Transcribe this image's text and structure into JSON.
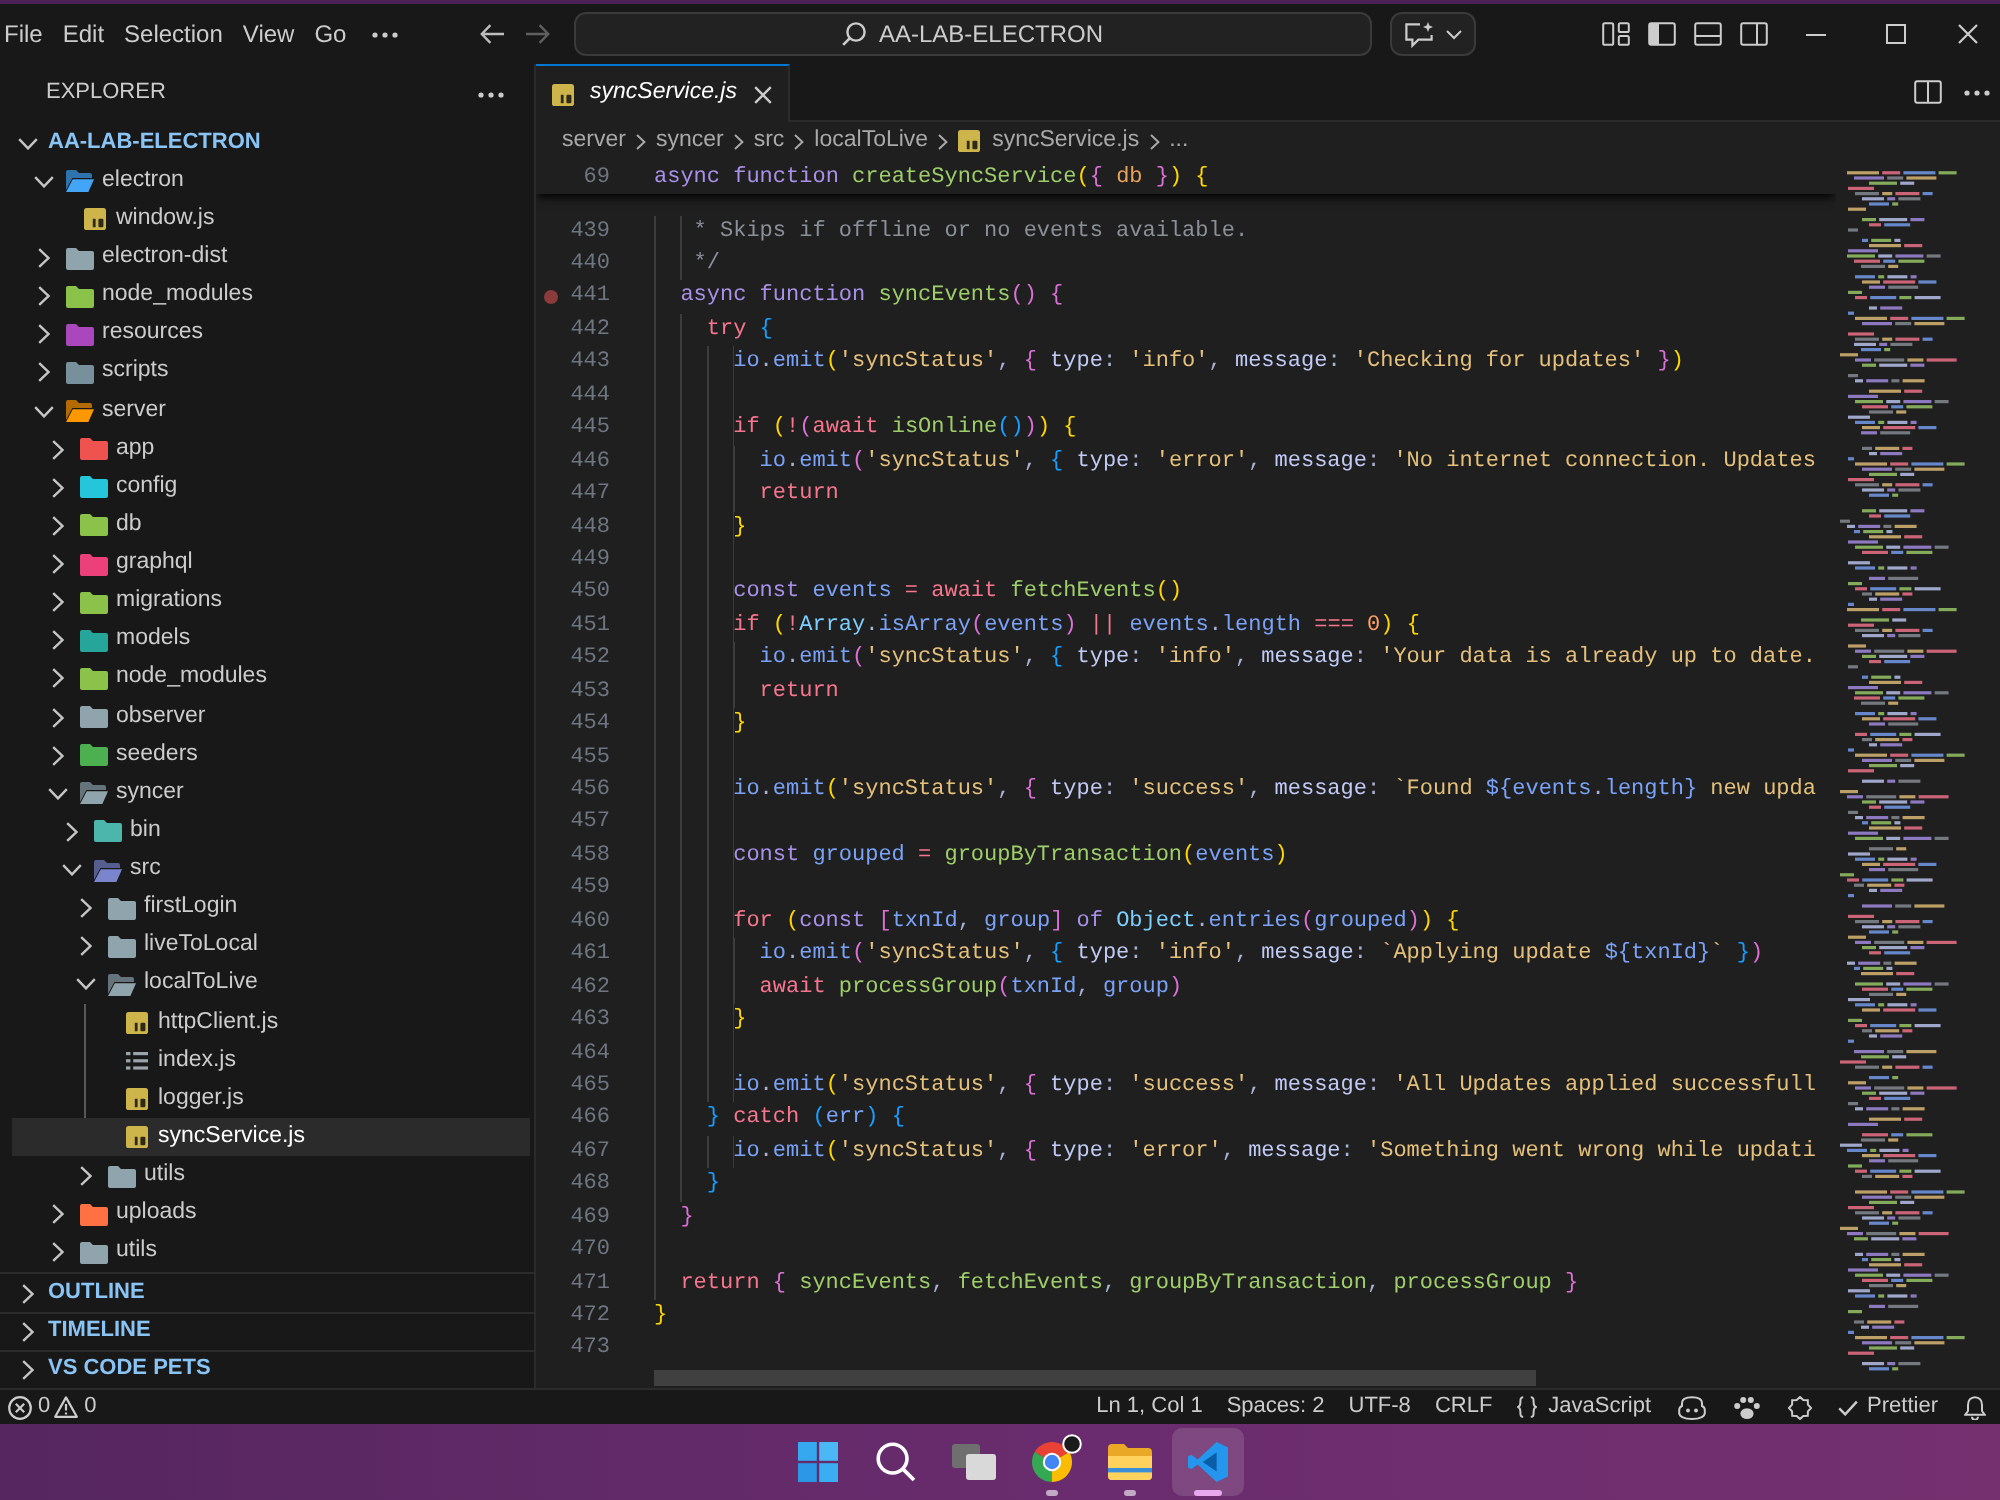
{
  "menu_bar": {
    "items": [
      "File",
      "Edit",
      "Selection",
      "View",
      "Go"
    ]
  },
  "navigation": [
    {
      "kind": "back",
      "disabled": false
    },
    {
      "kind": "forward",
      "disabled": true
    }
  ],
  "command_center": {
    "text": "AA-LAB-ELECTRON"
  },
  "layout_toggles": [
    {
      "kind": "customize",
      "on": false
    },
    {
      "kind": "primary_sidebar",
      "on": true
    },
    {
      "kind": "panel",
      "on": false
    },
    {
      "kind": "secondary_sidebar",
      "on": false
    }
  ],
  "sidebar": {
    "title": "EXPLORER",
    "root": {
      "label": "AA-LAB-ELECTRON",
      "expanded": true
    },
    "tree": [
      {
        "label": "electron",
        "kind": "folder",
        "color": "#42a5f5",
        "expanded": true,
        "selected": false,
        "children": [
          {
            "label": "window.js",
            "kind": "script",
            "selected": false
          }
        ]
      },
      {
        "label": "electron-dist",
        "kind": "folder",
        "color": "#90a4ae",
        "expanded": false,
        "selected": false
      },
      {
        "label": "node_modules",
        "kind": "folder",
        "color": "#8bc34a",
        "expanded": false,
        "selected": false
      },
      {
        "label": "resources",
        "kind": "folder",
        "color": "#ab47bc",
        "expanded": false,
        "selected": false
      },
      {
        "label": "scripts",
        "kind": "folder",
        "color": "#78909c",
        "expanded": false,
        "selected": false
      },
      {
        "label": "server",
        "kind": "folder",
        "color": "#ff9800",
        "expanded": true,
        "selected": false,
        "children": [
          {
            "label": "app",
            "kind": "folder",
            "color": "#ef5350",
            "expanded": false,
            "selected": false
          },
          {
            "label": "config",
            "kind": "folder",
            "color": "#26c6da",
            "expanded": false,
            "selected": false
          },
          {
            "label": "db",
            "kind": "folder",
            "color": "#8bc34a",
            "expanded": false,
            "selected": false
          },
          {
            "label": "graphql",
            "kind": "folder",
            "color": "#ec407a",
            "expanded": false,
            "selected": false
          },
          {
            "label": "migrations",
            "kind": "folder",
            "color": "#8bc34a",
            "expanded": false,
            "selected": false
          },
          {
            "label": "models",
            "kind": "folder",
            "color": "#26a69a",
            "expanded": false,
            "selected": false
          },
          {
            "label": "node_modules",
            "kind": "folder",
            "color": "#8bc34a",
            "expanded": false,
            "selected": false
          },
          {
            "label": "observer",
            "kind": "folder",
            "color": "#90a4ae",
            "expanded": false,
            "selected": false
          },
          {
            "label": "seeders",
            "kind": "folder",
            "color": "#4caf50",
            "expanded": false,
            "selected": false
          },
          {
            "label": "syncer",
            "kind": "folder",
            "color": "#90a4ae",
            "expanded": true,
            "selected": false,
            "children": [
              {
                "label": "bin",
                "kind": "folder",
                "color": "#4db6ac",
                "expanded": false,
                "selected": false
              },
              {
                "label": "src",
                "kind": "folder",
                "color": "#7986cb",
                "expanded": true,
                "selected": false,
                "children": [
                  {
                    "label": "firstLogin",
                    "kind": "folder",
                    "color": "#90a4ae",
                    "expanded": false,
                    "selected": false
                  },
                  {
                    "label": "liveToLocal",
                    "kind": "folder",
                    "color": "#90a4ae",
                    "expanded": false,
                    "selected": false
                  },
                  {
                    "label": "localToLive",
                    "kind": "folder",
                    "color": "#90a4ae",
                    "expanded": true,
                    "selected": false,
                    "children": [
                      {
                        "label": "httpClient.js",
                        "kind": "script",
                        "selected": false
                      },
                      {
                        "label": "index.js",
                        "kind": "list",
                        "selected": false
                      },
                      {
                        "label": "logger.js",
                        "kind": "script",
                        "selected": false
                      },
                      {
                        "label": "syncService.js",
                        "kind": "script",
                        "selected": true
                      }
                    ]
                  },
                  {
                    "label": "utils",
                    "kind": "folder",
                    "color": "#90a4ae",
                    "expanded": false,
                    "selected": false
                  }
                ]
              }
            ]
          },
          {
            "label": "uploads",
            "kind": "folder",
            "color": "#ff7043",
            "expanded": false,
            "selected": false
          },
          {
            "label": "utils",
            "kind": "folder",
            "color": "#90a4ae",
            "expanded": false,
            "selected": false
          }
        ]
      }
    ],
    "sections": [
      {
        "label": "OUTLINE",
        "expanded": false
      },
      {
        "label": "TIMELINE",
        "expanded": false
      },
      {
        "label": "VS CODE PETS",
        "expanded": false
      }
    ]
  },
  "editor": {
    "tabs": [
      {
        "label": "syncService.js",
        "kind": "script",
        "selected": true,
        "preview": true
      }
    ],
    "breadcrumb": [
      {
        "label": "server",
        "kind": "folder"
      },
      {
        "label": "syncer",
        "kind": "folder"
      },
      {
        "label": "src",
        "kind": "folder"
      },
      {
        "label": "localToLive",
        "kind": "folder"
      },
      {
        "label": "syncService.js",
        "kind": "script"
      },
      {
        "label": "...",
        "kind": "more"
      }
    ],
    "sticky_lines": [
      {
        "number": "69",
        "tokens": [
          {
            "kind": "kw",
            "text": "async function "
          },
          {
            "kind": "fn",
            "text": "createSyncService"
          },
          {
            "kind": "br1",
            "text": "("
          },
          {
            "kind": "br2",
            "text": "{ "
          },
          {
            "kind": "param",
            "text": "db"
          },
          {
            "kind": "br2",
            "text": " }"
          },
          {
            "kind": "br1",
            "text": ")"
          },
          {
            "kind": "br1",
            "text": " {"
          }
        ]
      }
    ],
    "lines": [
      {
        "number": "439",
        "breakpoint": false,
        "tokens": [
          {
            "kind": "cmt",
            "text": "   * Skips if offline or no events available."
          }
        ]
      },
      {
        "number": "440",
        "breakpoint": false,
        "tokens": [
          {
            "kind": "cmt",
            "text": "   */"
          }
        ]
      },
      {
        "number": "441",
        "breakpoint": true,
        "tokens": [
          {
            "kind": "kw",
            "text": "  async function "
          },
          {
            "kind": "fn",
            "text": "syncEvents"
          },
          {
            "kind": "br2",
            "text": "() {"
          }
        ]
      },
      {
        "number": "442",
        "breakpoint": false,
        "tokens": [
          {
            "kind": "ctl",
            "text": "    try "
          },
          {
            "kind": "br3",
            "text": "{"
          }
        ]
      },
      {
        "number": "443",
        "breakpoint": false,
        "tokens": [
          {
            "kind": "var",
            "text": "      io"
          },
          {
            "kind": "pun",
            "text": "."
          },
          {
            "kind": "var",
            "text": "emit"
          },
          {
            "kind": "br1",
            "text": "("
          },
          {
            "kind": "str",
            "text": "'syncStatus'"
          },
          {
            "kind": "pun",
            "text": ", "
          },
          {
            "kind": "br2",
            "text": "{ "
          },
          {
            "kind": "prop",
            "text": "type"
          },
          {
            "kind": "pun",
            "text": ": "
          },
          {
            "kind": "str",
            "text": "'info'"
          },
          {
            "kind": "pun",
            "text": ", "
          },
          {
            "kind": "prop",
            "text": "message"
          },
          {
            "kind": "pun",
            "text": ": "
          },
          {
            "kind": "str",
            "text": "'Checking for updates'"
          },
          {
            "kind": "br2",
            "text": " }"
          },
          {
            "kind": "br1",
            "text": ")"
          }
        ]
      },
      {
        "number": "444",
        "breakpoint": false
      },
      {
        "number": "445",
        "breakpoint": false,
        "tokens": [
          {
            "kind": "ctl",
            "text": "      if "
          },
          {
            "kind": "br1",
            "text": "("
          },
          {
            "kind": "ctl",
            "text": "!"
          },
          {
            "kind": "br2",
            "text": "("
          },
          {
            "kind": "ctl",
            "text": "await "
          },
          {
            "kind": "fn",
            "text": "isOnline"
          },
          {
            "kind": "br3",
            "text": "()"
          },
          {
            "kind": "br2",
            "text": ")"
          },
          {
            "kind": "br1",
            "text": ") {"
          }
        ]
      },
      {
        "number": "446",
        "breakpoint": false,
        "tokens": [
          {
            "kind": "var",
            "text": "        io"
          },
          {
            "kind": "pun",
            "text": "."
          },
          {
            "kind": "var",
            "text": "emit"
          },
          {
            "kind": "br2",
            "text": "("
          },
          {
            "kind": "str",
            "text": "'syncStatus'"
          },
          {
            "kind": "pun",
            "text": ", "
          },
          {
            "kind": "br3",
            "text": "{ "
          },
          {
            "kind": "prop",
            "text": "type"
          },
          {
            "kind": "pun",
            "text": ": "
          },
          {
            "kind": "str",
            "text": "'error'"
          },
          {
            "kind": "pun",
            "text": ", "
          },
          {
            "kind": "prop",
            "text": "message"
          },
          {
            "kind": "pun",
            "text": ": "
          },
          {
            "kind": "str",
            "text": "'No internet connection. Updates"
          }
        ]
      },
      {
        "number": "447",
        "breakpoint": false,
        "tokens": [
          {
            "kind": "ctl",
            "text": "        return"
          }
        ]
      },
      {
        "number": "448",
        "breakpoint": false,
        "tokens": [
          {
            "kind": "br1",
            "text": "      }"
          }
        ]
      },
      {
        "number": "449",
        "breakpoint": false
      },
      {
        "number": "450",
        "breakpoint": false,
        "tokens": [
          {
            "kind": "kw",
            "text": "      const "
          },
          {
            "kind": "var",
            "text": "events "
          },
          {
            "kind": "ctl",
            "text": "= await "
          },
          {
            "kind": "fn",
            "text": "fetchEvents"
          },
          {
            "kind": "br1",
            "text": "()"
          }
        ]
      },
      {
        "number": "451",
        "breakpoint": false,
        "tokens": [
          {
            "kind": "ctl",
            "text": "      if "
          },
          {
            "kind": "br1",
            "text": "("
          },
          {
            "kind": "ctl",
            "text": "!"
          },
          {
            "kind": "cls",
            "text": "Array"
          },
          {
            "kind": "pun",
            "text": "."
          },
          {
            "kind": "var",
            "text": "isArray"
          },
          {
            "kind": "br2",
            "text": "("
          },
          {
            "kind": "var",
            "text": "events"
          },
          {
            "kind": "br2",
            "text": ")"
          },
          {
            "kind": "ctl",
            "text": " || "
          },
          {
            "kind": "var",
            "text": "events"
          },
          {
            "kind": "pun",
            "text": "."
          },
          {
            "kind": "var",
            "text": "length"
          },
          {
            "kind": "ctl",
            "text": " === "
          },
          {
            "kind": "num",
            "text": "0"
          },
          {
            "kind": "br1",
            "text": ") {"
          }
        ]
      },
      {
        "number": "452",
        "breakpoint": false,
        "tokens": [
          {
            "kind": "var",
            "text": "        io"
          },
          {
            "kind": "pun",
            "text": "."
          },
          {
            "kind": "var",
            "text": "emit"
          },
          {
            "kind": "br2",
            "text": "("
          },
          {
            "kind": "str",
            "text": "'syncStatus'"
          },
          {
            "kind": "pun",
            "text": ", "
          },
          {
            "kind": "br3",
            "text": "{ "
          },
          {
            "kind": "prop",
            "text": "type"
          },
          {
            "kind": "pun",
            "text": ": "
          },
          {
            "kind": "str",
            "text": "'info'"
          },
          {
            "kind": "pun",
            "text": ", "
          },
          {
            "kind": "prop",
            "text": "message"
          },
          {
            "kind": "pun",
            "text": ": "
          },
          {
            "kind": "str",
            "text": "'Your data is already up to date."
          }
        ]
      },
      {
        "number": "453",
        "breakpoint": false,
        "tokens": [
          {
            "kind": "ctl",
            "text": "        return"
          }
        ]
      },
      {
        "number": "454",
        "breakpoint": false,
        "tokens": [
          {
            "kind": "br1",
            "text": "      }"
          }
        ]
      },
      {
        "number": "455",
        "breakpoint": false
      },
      {
        "number": "456",
        "breakpoint": false,
        "tokens": [
          {
            "kind": "var",
            "text": "      io"
          },
          {
            "kind": "pun",
            "text": "."
          },
          {
            "kind": "var",
            "text": "emit"
          },
          {
            "kind": "br1",
            "text": "("
          },
          {
            "kind": "str",
            "text": "'syncStatus'"
          },
          {
            "kind": "pun",
            "text": ", "
          },
          {
            "kind": "br2",
            "text": "{ "
          },
          {
            "kind": "prop",
            "text": "type"
          },
          {
            "kind": "pun",
            "text": ": "
          },
          {
            "kind": "str",
            "text": "'success'"
          },
          {
            "kind": "pun",
            "text": ", "
          },
          {
            "kind": "prop",
            "text": "message"
          },
          {
            "kind": "pun",
            "text": ": "
          },
          {
            "kind": "str",
            "text": "`Found "
          },
          {
            "kind": "tpl",
            "text": "${"
          },
          {
            "kind": "var",
            "text": "events"
          },
          {
            "kind": "pun",
            "text": "."
          },
          {
            "kind": "var",
            "text": "length"
          },
          {
            "kind": "tpl",
            "text": "}"
          },
          {
            "kind": "str",
            "text": " new upda"
          }
        ]
      },
      {
        "number": "457",
        "breakpoint": false
      },
      {
        "number": "458",
        "breakpoint": false,
        "tokens": [
          {
            "kind": "kw",
            "text": "      const "
          },
          {
            "kind": "var",
            "text": "grouped "
          },
          {
            "kind": "ctl",
            "text": "= "
          },
          {
            "kind": "fn",
            "text": "groupByTransaction"
          },
          {
            "kind": "br1",
            "text": "("
          },
          {
            "kind": "var",
            "text": "events"
          },
          {
            "kind": "br1",
            "text": ")"
          }
        ]
      },
      {
        "number": "459",
        "breakpoint": false
      },
      {
        "number": "460",
        "breakpoint": false,
        "tokens": [
          {
            "kind": "ctl",
            "text": "      for "
          },
          {
            "kind": "br1",
            "text": "("
          },
          {
            "kind": "kw",
            "text": "const "
          },
          {
            "kind": "br2",
            "text": "["
          },
          {
            "kind": "var",
            "text": "txnId"
          },
          {
            "kind": "pun",
            "text": ", "
          },
          {
            "kind": "var",
            "text": "group"
          },
          {
            "kind": "br2",
            "text": "]"
          },
          {
            "kind": "kw",
            "text": " of "
          },
          {
            "kind": "cls",
            "text": "Object"
          },
          {
            "kind": "pun",
            "text": "."
          },
          {
            "kind": "var",
            "text": "entries"
          },
          {
            "kind": "br2",
            "text": "("
          },
          {
            "kind": "var",
            "text": "grouped"
          },
          {
            "kind": "br2",
            "text": ")"
          },
          {
            "kind": "br1",
            "text": ") {"
          }
        ]
      },
      {
        "number": "461",
        "breakpoint": false,
        "tokens": [
          {
            "kind": "var",
            "text": "        io"
          },
          {
            "kind": "pun",
            "text": "."
          },
          {
            "kind": "var",
            "text": "emit"
          },
          {
            "kind": "br2",
            "text": "("
          },
          {
            "kind": "str",
            "text": "'syncStatus'"
          },
          {
            "kind": "pun",
            "text": ", "
          },
          {
            "kind": "br3",
            "text": "{ "
          },
          {
            "kind": "prop",
            "text": "type"
          },
          {
            "kind": "pun",
            "text": ": "
          },
          {
            "kind": "str",
            "text": "'info'"
          },
          {
            "kind": "pun",
            "text": ", "
          },
          {
            "kind": "prop",
            "text": "message"
          },
          {
            "kind": "pun",
            "text": ": "
          },
          {
            "kind": "str",
            "text": "`Applying update "
          },
          {
            "kind": "tpl",
            "text": "${"
          },
          {
            "kind": "var",
            "text": "txnId"
          },
          {
            "kind": "tpl",
            "text": "}"
          },
          {
            "kind": "str",
            "text": "`"
          },
          {
            "kind": "br3",
            "text": " }"
          },
          {
            "kind": "br2",
            "text": ")"
          }
        ]
      },
      {
        "number": "462",
        "breakpoint": false,
        "tokens": [
          {
            "kind": "ctl",
            "text": "        await "
          },
          {
            "kind": "fn",
            "text": "processGroup"
          },
          {
            "kind": "br2",
            "text": "("
          },
          {
            "kind": "var",
            "text": "txnId"
          },
          {
            "kind": "pun",
            "text": ", "
          },
          {
            "kind": "var",
            "text": "group"
          },
          {
            "kind": "br2",
            "text": ")"
          }
        ]
      },
      {
        "number": "463",
        "breakpoint": false,
        "tokens": [
          {
            "kind": "br1",
            "text": "      }"
          }
        ]
      },
      {
        "number": "464",
        "breakpoint": false
      },
      {
        "number": "465",
        "breakpoint": false,
        "tokens": [
          {
            "kind": "var",
            "text": "      io"
          },
          {
            "kind": "pun",
            "text": "."
          },
          {
            "kind": "var",
            "text": "emit"
          },
          {
            "kind": "br1",
            "text": "("
          },
          {
            "kind": "str",
            "text": "'syncStatus'"
          },
          {
            "kind": "pun",
            "text": ", "
          },
          {
            "kind": "br2",
            "text": "{ "
          },
          {
            "kind": "prop",
            "text": "type"
          },
          {
            "kind": "pun",
            "text": ": "
          },
          {
            "kind": "str",
            "text": "'success'"
          },
          {
            "kind": "pun",
            "text": ", "
          },
          {
            "kind": "prop",
            "text": "message"
          },
          {
            "kind": "pun",
            "text": ": "
          },
          {
            "kind": "str",
            "text": "'All Updates applied successfull"
          }
        ]
      },
      {
        "number": "466",
        "breakpoint": false,
        "tokens": [
          {
            "kind": "br3",
            "text": "    } "
          },
          {
            "kind": "ctl",
            "text": "catch "
          },
          {
            "kind": "br3",
            "text": "("
          },
          {
            "kind": "var",
            "text": "err"
          },
          {
            "kind": "br3",
            "text": ") {"
          }
        ]
      },
      {
        "number": "467",
        "breakpoint": false,
        "tokens": [
          {
            "kind": "var",
            "text": "      io"
          },
          {
            "kind": "pun",
            "text": "."
          },
          {
            "kind": "var",
            "text": "emit"
          },
          {
            "kind": "br1",
            "text": "("
          },
          {
            "kind": "str",
            "text": "'syncStatus'"
          },
          {
            "kind": "pun",
            "text": ", "
          },
          {
            "kind": "br2",
            "text": "{ "
          },
          {
            "kind": "prop",
            "text": "type"
          },
          {
            "kind": "pun",
            "text": ": "
          },
          {
            "kind": "str",
            "text": "'error'"
          },
          {
            "kind": "pun",
            "text": ", "
          },
          {
            "kind": "prop",
            "text": "message"
          },
          {
            "kind": "pun",
            "text": ": "
          },
          {
            "kind": "str",
            "text": "'Something went wrong while updati"
          }
        ]
      },
      {
        "number": "468",
        "breakpoint": false,
        "tokens": [
          {
            "kind": "br3",
            "text": "    }"
          }
        ]
      },
      {
        "number": "469",
        "breakpoint": false,
        "tokens": [
          {
            "kind": "br2",
            "text": "  }"
          }
        ]
      },
      {
        "number": "470",
        "breakpoint": false
      },
      {
        "number": "471",
        "breakpoint": false,
        "tokens": [
          {
            "kind": "ctl",
            "text": "  return "
          },
          {
            "kind": "br2",
            "text": "{ "
          },
          {
            "kind": "fn",
            "text": "syncEvents"
          },
          {
            "kind": "pun",
            "text": ", "
          },
          {
            "kind": "fn",
            "text": "fetchEvents"
          },
          {
            "kind": "pun",
            "text": ", "
          },
          {
            "kind": "fn",
            "text": "groupByTransaction"
          },
          {
            "kind": "pun",
            "text": ", "
          },
          {
            "kind": "fn",
            "text": "processGroup"
          },
          {
            "kind": "br2",
            "text": " }"
          }
        ]
      },
      {
        "number": "472",
        "breakpoint": false,
        "tokens": [
          {
            "kind": "br1",
            "text": "}"
          }
        ]
      },
      {
        "number": "473",
        "breakpoint": false
      }
    ]
  },
  "status_bar": {
    "problems": [
      {
        "kind": "error",
        "count": "0"
      },
      {
        "kind": "warning",
        "count": "0"
      }
    ],
    "items": [
      {
        "kind": "text",
        "text": "Ln 1, Col 1"
      },
      {
        "kind": "text",
        "text": "Spaces: 2"
      },
      {
        "kind": "text",
        "text": "UTF-8"
      },
      {
        "kind": "text",
        "text": "CRLF"
      },
      {
        "kind": "language",
        "text": "JavaScript"
      },
      {
        "kind": "copilot"
      },
      {
        "kind": "pets"
      },
      {
        "kind": "extension"
      },
      {
        "kind": "formatter",
        "text": "Prettier"
      },
      {
        "kind": "notifications"
      }
    ]
  },
  "taskbar": {
    "items": [
      {
        "kind": "start",
        "running": false,
        "selected": false,
        "notification": false
      },
      {
        "kind": "search",
        "running": false,
        "selected": false,
        "notification": false
      },
      {
        "kind": "task_view",
        "running": false,
        "selected": false,
        "notification": false
      },
      {
        "kind": "browser",
        "running": true,
        "selected": false,
        "notification": true
      },
      {
        "kind": "files",
        "running": true,
        "selected": false,
        "notification": false
      },
      {
        "kind": "editor",
        "running": true,
        "selected": true,
        "notification": false
      }
    ]
  }
}
